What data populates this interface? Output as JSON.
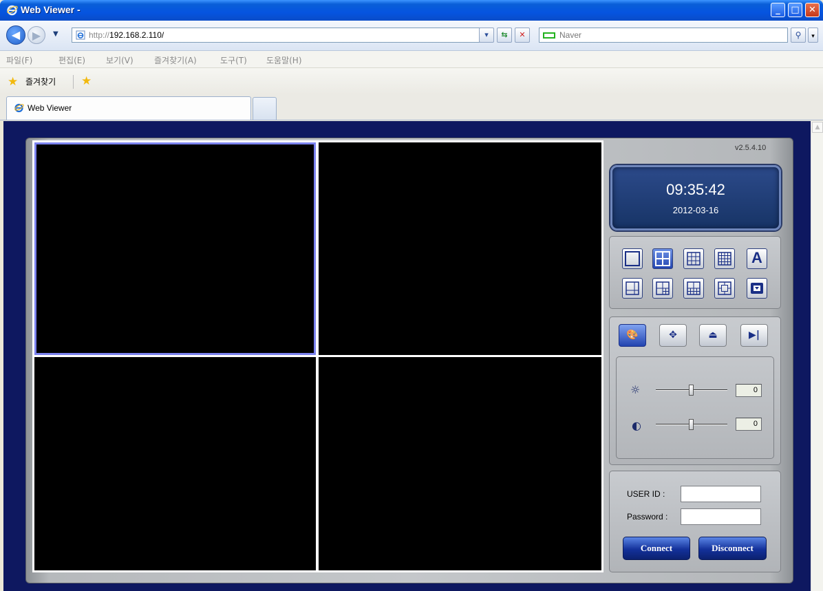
{
  "window": {
    "title": "Web Viewer -"
  },
  "address": {
    "url_prefix": "http://",
    "url_host": "192.168.2.110/",
    "search_placeholder": "Naver"
  },
  "menu": [
    "파일(F)",
    "편집(E)",
    "보기(V)",
    "즐겨찾기(A)",
    "도구(T)",
    "도움말(H)"
  ],
  "favorites": {
    "label": "즐겨찾기"
  },
  "tab": {
    "label": "Web Viewer"
  },
  "viewer": {
    "version": "v2.5.4.10",
    "time": "09:35:42",
    "date": "2012-03-16",
    "brightness_value": "0",
    "contrast_value": "0",
    "brightness_level": 0.5,
    "contrast_level": 0.5,
    "user_id_label": "USER ID :",
    "password_label": "Password :",
    "connect_label": "Connect",
    "disconnect_label": "Disconnect",
    "layout_a_label": "A"
  },
  "colors": {
    "accent": "#7b82ee",
    "background": "#0e1860",
    "clock_bg": "#173466"
  }
}
